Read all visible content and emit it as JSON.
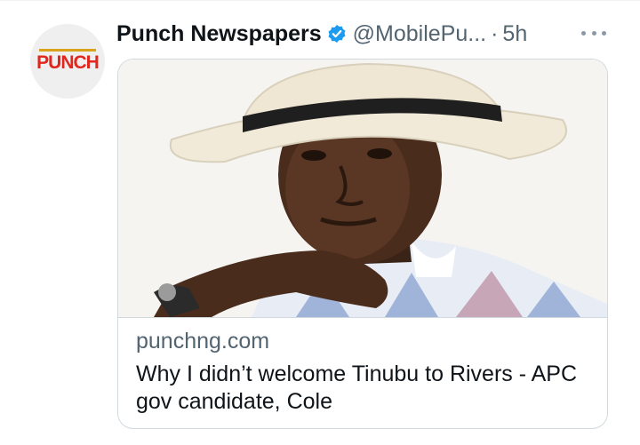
{
  "account": {
    "avatar_logo_text": "PUNCH",
    "display_name": "Punch Newspapers",
    "handle": "@MobilePu...",
    "separator": "·",
    "timestamp": "5h",
    "verified_icon": "verified-badge-icon",
    "more_icon": "more-options-icon"
  },
  "card": {
    "image_alt": "Portrait of a man wearing a white fedora hat with a black band",
    "domain": "punchng.com",
    "headline": "Why I didn’t welcome Tinubu to Rivers - APC gov candidate, Cole"
  },
  "colors": {
    "verified": "#1d9bf0",
    "punch_red": "#e0261d",
    "secondary_text": "#536471",
    "primary_text": "#0f1419"
  }
}
